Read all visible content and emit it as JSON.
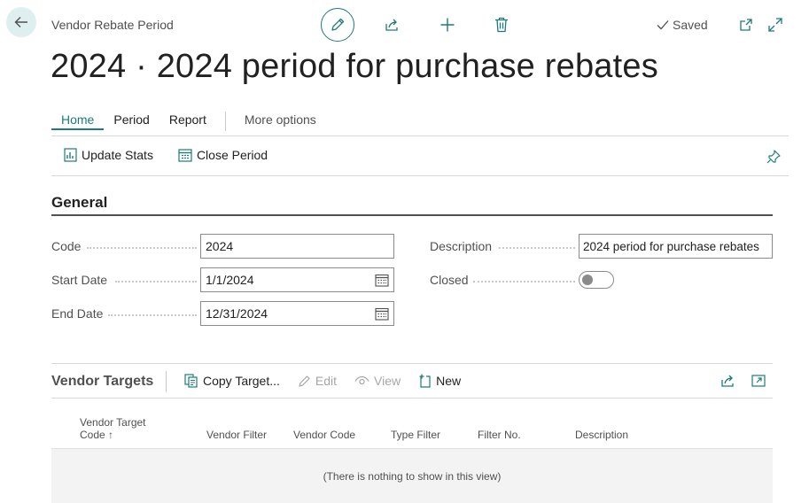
{
  "header": {
    "caption": "Vendor Rebate Period",
    "saved_label": "Saved",
    "title": "2024 · 2024 period for purchase rebates"
  },
  "tabs": [
    {
      "label": "Home",
      "active": true
    },
    {
      "label": "Period",
      "active": false
    },
    {
      "label": "Report",
      "active": false
    },
    {
      "label": "More options",
      "active": false
    }
  ],
  "actions": {
    "update_stats": "Update Stats",
    "close_period": "Close Period"
  },
  "general": {
    "title": "General",
    "code_label": "Code",
    "code_value": "2024",
    "start_date_label": "Start Date",
    "start_date_value": "1/1/2024",
    "end_date_label": "End Date",
    "end_date_value": "12/31/2024",
    "description_label": "Description",
    "description_value": "2024 period for purchase rebates",
    "closed_label": "Closed",
    "closed_value": false
  },
  "vendor_targets": {
    "title": "Vendor Targets",
    "copy_target": "Copy Target...",
    "edit": "Edit",
    "view": "View",
    "new": "New",
    "columns": [
      "Vendor Target Code ↑",
      "Vendor Filter",
      "Vendor Code",
      "Type Filter",
      "Filter No.",
      "Description"
    ],
    "empty_message": "(There is nothing to show in this view)"
  },
  "icons": {
    "back": "back-arrow-icon",
    "edit": "pencil-icon",
    "share": "share-icon",
    "add": "plus-icon",
    "delete": "trash-icon",
    "saved": "checkmark-icon",
    "open_new": "open-in-new-window-icon",
    "expand": "expand-icon",
    "pin": "pin-icon",
    "calendar": "calendar-icon"
  },
  "colors": {
    "accent": "#1f7a7a",
    "back_bg": "#dfeeee",
    "text": "#212121",
    "muted": "#505050"
  }
}
